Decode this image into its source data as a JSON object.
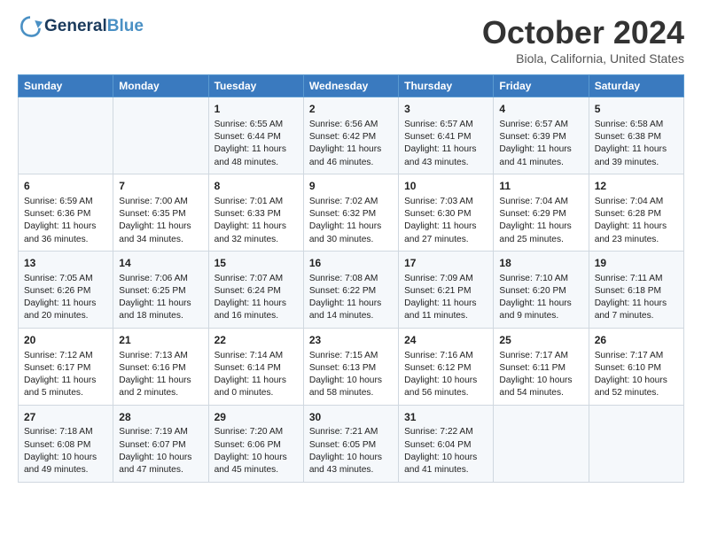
{
  "header": {
    "logo_line1": "General",
    "logo_line2": "Blue",
    "month": "October 2024",
    "location": "Biola, California, United States"
  },
  "days_of_week": [
    "Sunday",
    "Monday",
    "Tuesday",
    "Wednesday",
    "Thursday",
    "Friday",
    "Saturday"
  ],
  "weeks": [
    [
      {
        "day": "",
        "sunrise": "",
        "sunset": "",
        "daylight": ""
      },
      {
        "day": "",
        "sunrise": "",
        "sunset": "",
        "daylight": ""
      },
      {
        "day": "1",
        "sunrise": "Sunrise: 6:55 AM",
        "sunset": "Sunset: 6:44 PM",
        "daylight": "Daylight: 11 hours and 48 minutes."
      },
      {
        "day": "2",
        "sunrise": "Sunrise: 6:56 AM",
        "sunset": "Sunset: 6:42 PM",
        "daylight": "Daylight: 11 hours and 46 minutes."
      },
      {
        "day": "3",
        "sunrise": "Sunrise: 6:57 AM",
        "sunset": "Sunset: 6:41 PM",
        "daylight": "Daylight: 11 hours and 43 minutes."
      },
      {
        "day": "4",
        "sunrise": "Sunrise: 6:57 AM",
        "sunset": "Sunset: 6:39 PM",
        "daylight": "Daylight: 11 hours and 41 minutes."
      },
      {
        "day": "5",
        "sunrise": "Sunrise: 6:58 AM",
        "sunset": "Sunset: 6:38 PM",
        "daylight": "Daylight: 11 hours and 39 minutes."
      }
    ],
    [
      {
        "day": "6",
        "sunrise": "Sunrise: 6:59 AM",
        "sunset": "Sunset: 6:36 PM",
        "daylight": "Daylight: 11 hours and 36 minutes."
      },
      {
        "day": "7",
        "sunrise": "Sunrise: 7:00 AM",
        "sunset": "Sunset: 6:35 PM",
        "daylight": "Daylight: 11 hours and 34 minutes."
      },
      {
        "day": "8",
        "sunrise": "Sunrise: 7:01 AM",
        "sunset": "Sunset: 6:33 PM",
        "daylight": "Daylight: 11 hours and 32 minutes."
      },
      {
        "day": "9",
        "sunrise": "Sunrise: 7:02 AM",
        "sunset": "Sunset: 6:32 PM",
        "daylight": "Daylight: 11 hours and 30 minutes."
      },
      {
        "day": "10",
        "sunrise": "Sunrise: 7:03 AM",
        "sunset": "Sunset: 6:30 PM",
        "daylight": "Daylight: 11 hours and 27 minutes."
      },
      {
        "day": "11",
        "sunrise": "Sunrise: 7:04 AM",
        "sunset": "Sunset: 6:29 PM",
        "daylight": "Daylight: 11 hours and 25 minutes."
      },
      {
        "day": "12",
        "sunrise": "Sunrise: 7:04 AM",
        "sunset": "Sunset: 6:28 PM",
        "daylight": "Daylight: 11 hours and 23 minutes."
      }
    ],
    [
      {
        "day": "13",
        "sunrise": "Sunrise: 7:05 AM",
        "sunset": "Sunset: 6:26 PM",
        "daylight": "Daylight: 11 hours and 20 minutes."
      },
      {
        "day": "14",
        "sunrise": "Sunrise: 7:06 AM",
        "sunset": "Sunset: 6:25 PM",
        "daylight": "Daylight: 11 hours and 18 minutes."
      },
      {
        "day": "15",
        "sunrise": "Sunrise: 7:07 AM",
        "sunset": "Sunset: 6:24 PM",
        "daylight": "Daylight: 11 hours and 16 minutes."
      },
      {
        "day": "16",
        "sunrise": "Sunrise: 7:08 AM",
        "sunset": "Sunset: 6:22 PM",
        "daylight": "Daylight: 11 hours and 14 minutes."
      },
      {
        "day": "17",
        "sunrise": "Sunrise: 7:09 AM",
        "sunset": "Sunset: 6:21 PM",
        "daylight": "Daylight: 11 hours and 11 minutes."
      },
      {
        "day": "18",
        "sunrise": "Sunrise: 7:10 AM",
        "sunset": "Sunset: 6:20 PM",
        "daylight": "Daylight: 11 hours and 9 minutes."
      },
      {
        "day": "19",
        "sunrise": "Sunrise: 7:11 AM",
        "sunset": "Sunset: 6:18 PM",
        "daylight": "Daylight: 11 hours and 7 minutes."
      }
    ],
    [
      {
        "day": "20",
        "sunrise": "Sunrise: 7:12 AM",
        "sunset": "Sunset: 6:17 PM",
        "daylight": "Daylight: 11 hours and 5 minutes."
      },
      {
        "day": "21",
        "sunrise": "Sunrise: 7:13 AM",
        "sunset": "Sunset: 6:16 PM",
        "daylight": "Daylight: 11 hours and 2 minutes."
      },
      {
        "day": "22",
        "sunrise": "Sunrise: 7:14 AM",
        "sunset": "Sunset: 6:14 PM",
        "daylight": "Daylight: 11 hours and 0 minutes."
      },
      {
        "day": "23",
        "sunrise": "Sunrise: 7:15 AM",
        "sunset": "Sunset: 6:13 PM",
        "daylight": "Daylight: 10 hours and 58 minutes."
      },
      {
        "day": "24",
        "sunrise": "Sunrise: 7:16 AM",
        "sunset": "Sunset: 6:12 PM",
        "daylight": "Daylight: 10 hours and 56 minutes."
      },
      {
        "day": "25",
        "sunrise": "Sunrise: 7:17 AM",
        "sunset": "Sunset: 6:11 PM",
        "daylight": "Daylight: 10 hours and 54 minutes."
      },
      {
        "day": "26",
        "sunrise": "Sunrise: 7:17 AM",
        "sunset": "Sunset: 6:10 PM",
        "daylight": "Daylight: 10 hours and 52 minutes."
      }
    ],
    [
      {
        "day": "27",
        "sunrise": "Sunrise: 7:18 AM",
        "sunset": "Sunset: 6:08 PM",
        "daylight": "Daylight: 10 hours and 49 minutes."
      },
      {
        "day": "28",
        "sunrise": "Sunrise: 7:19 AM",
        "sunset": "Sunset: 6:07 PM",
        "daylight": "Daylight: 10 hours and 47 minutes."
      },
      {
        "day": "29",
        "sunrise": "Sunrise: 7:20 AM",
        "sunset": "Sunset: 6:06 PM",
        "daylight": "Daylight: 10 hours and 45 minutes."
      },
      {
        "day": "30",
        "sunrise": "Sunrise: 7:21 AM",
        "sunset": "Sunset: 6:05 PM",
        "daylight": "Daylight: 10 hours and 43 minutes."
      },
      {
        "day": "31",
        "sunrise": "Sunrise: 7:22 AM",
        "sunset": "Sunset: 6:04 PM",
        "daylight": "Daylight: 10 hours and 41 minutes."
      },
      {
        "day": "",
        "sunrise": "",
        "sunset": "",
        "daylight": ""
      },
      {
        "day": "",
        "sunrise": "",
        "sunset": "",
        "daylight": ""
      }
    ]
  ]
}
